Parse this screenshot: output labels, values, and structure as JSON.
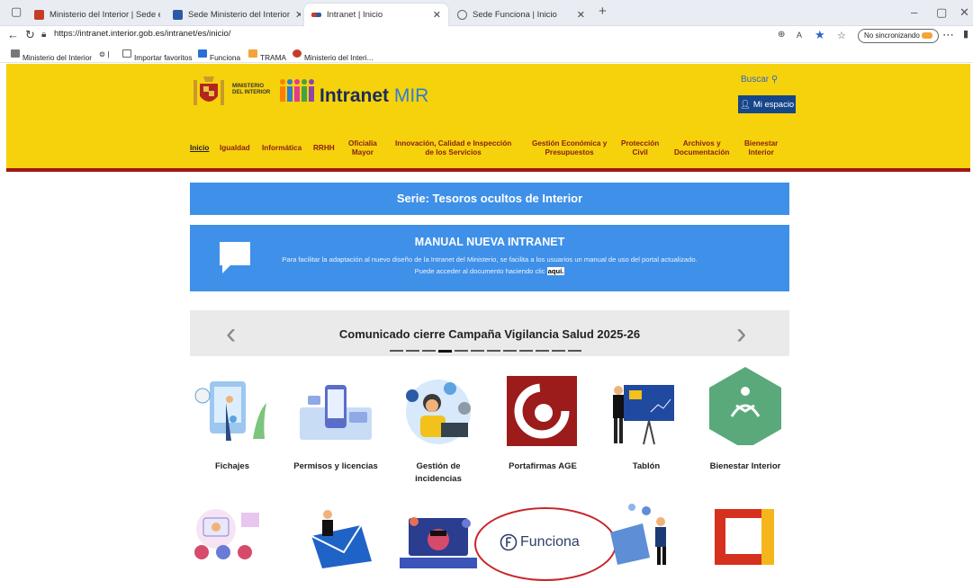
{
  "browser": {
    "tabs": [
      {
        "title": "Ministerio del Interior | Sede elec",
        "color": "#c53d27"
      },
      {
        "title": "Sede Ministerio del Interior",
        "color": "#2b5aa6"
      },
      {
        "title": "Intranet | Inicio",
        "color": "#c53d27"
      },
      {
        "title": "Sede Funciona | Inicio",
        "color": "#6c6c6c"
      }
    ],
    "url": "https://intranet.interior.gob.es/intranet/es/inicio/",
    "sync_label": "No sincronizando",
    "bookmarks": [
      "Ministerio del Interior",
      "Importar favoritos",
      "Funciona",
      "TRAMA",
      "Ministerio del Interi..."
    ]
  },
  "header": {
    "ministry": "MINISTERIO\nDEL INTERIOR",
    "brand": "Intranet",
    "brand_accent": "MIR",
    "search": "Buscar",
    "my_space": "Mi espacio",
    "menu": [
      "Inicio",
      "Igualdad",
      "Informática",
      "RRHH",
      "Oficialía\nMayor",
      "Innovación, Calidad e Inspección\nde los Servicios",
      "Gestión Económica y\nPresupuestos",
      "Protección\nCivil",
      "Archivos y\nDocumentación",
      "Bienestar\nInterior"
    ]
  },
  "banners": {
    "series": "Serie: Tesoros ocultos de Interior",
    "manual_title": "MANUAL NUEVA INTRANET",
    "manual_text": "Para facilitar la adaptación al nuevo diseño de la Intranet del Ministerio, se facilita a los usuarios un manual de uso del portal actualizado.",
    "manual_text2": "Puede acceder al documento haciendo clic",
    "manual_link": "aquí."
  },
  "carousel": {
    "title": "Comunicado cierre Campaña Vigilancia Salud 2025-26",
    "slides": 12,
    "active": 4
  },
  "tiles": [
    "Fichajes",
    "Permisos y licencias",
    "Gestión de\nincidencias",
    "Portafirmas AGE",
    "Tablón",
    "Bienestar Interior"
  ],
  "funciona_logo": "Funciona"
}
